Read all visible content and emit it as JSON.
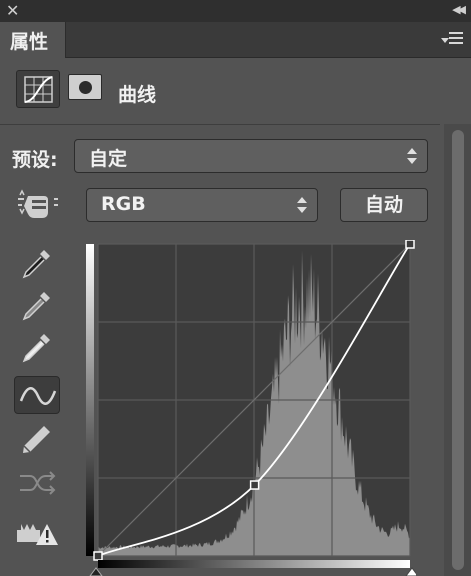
{
  "window": {
    "close_icon": "close-icon",
    "collapse_icon": "double-chevron-left-icon"
  },
  "panel": {
    "tab_label": "属性",
    "menu_icon": "panel-menu-icon"
  },
  "header": {
    "title": "曲线",
    "adjustment_icon": "curves-adjustment-icon",
    "mask_icon": "layer-mask-icon"
  },
  "preset": {
    "label": "预设:",
    "value": "自定"
  },
  "channel": {
    "value": "RGB"
  },
  "auto_button": {
    "label": "自动"
  },
  "tools": [
    {
      "name": "on-image-adjust-hand-icon"
    },
    {
      "name": "black-point-eyedropper-icon"
    },
    {
      "name": "gray-point-eyedropper-icon"
    },
    {
      "name": "white-point-eyedropper-icon"
    },
    {
      "name": "curve-edit-points-icon",
      "active": true
    },
    {
      "name": "pencil-draw-icon"
    },
    {
      "name": "smooth-curve-icon"
    },
    {
      "name": "clipping-warning-icon"
    }
  ],
  "curve": {
    "range": [
      0,
      255
    ],
    "grid_divisions": 4,
    "control_points": [
      {
        "input": 0,
        "output": 0
      },
      {
        "input": 128,
        "output": 58
      },
      {
        "input": 255,
        "output": 255
      }
    ],
    "colors": {
      "background": "#3c3c3c",
      "grid": "#5a5a5a",
      "histogram": "#8e8e8e",
      "curve": "#ffffff"
    }
  }
}
